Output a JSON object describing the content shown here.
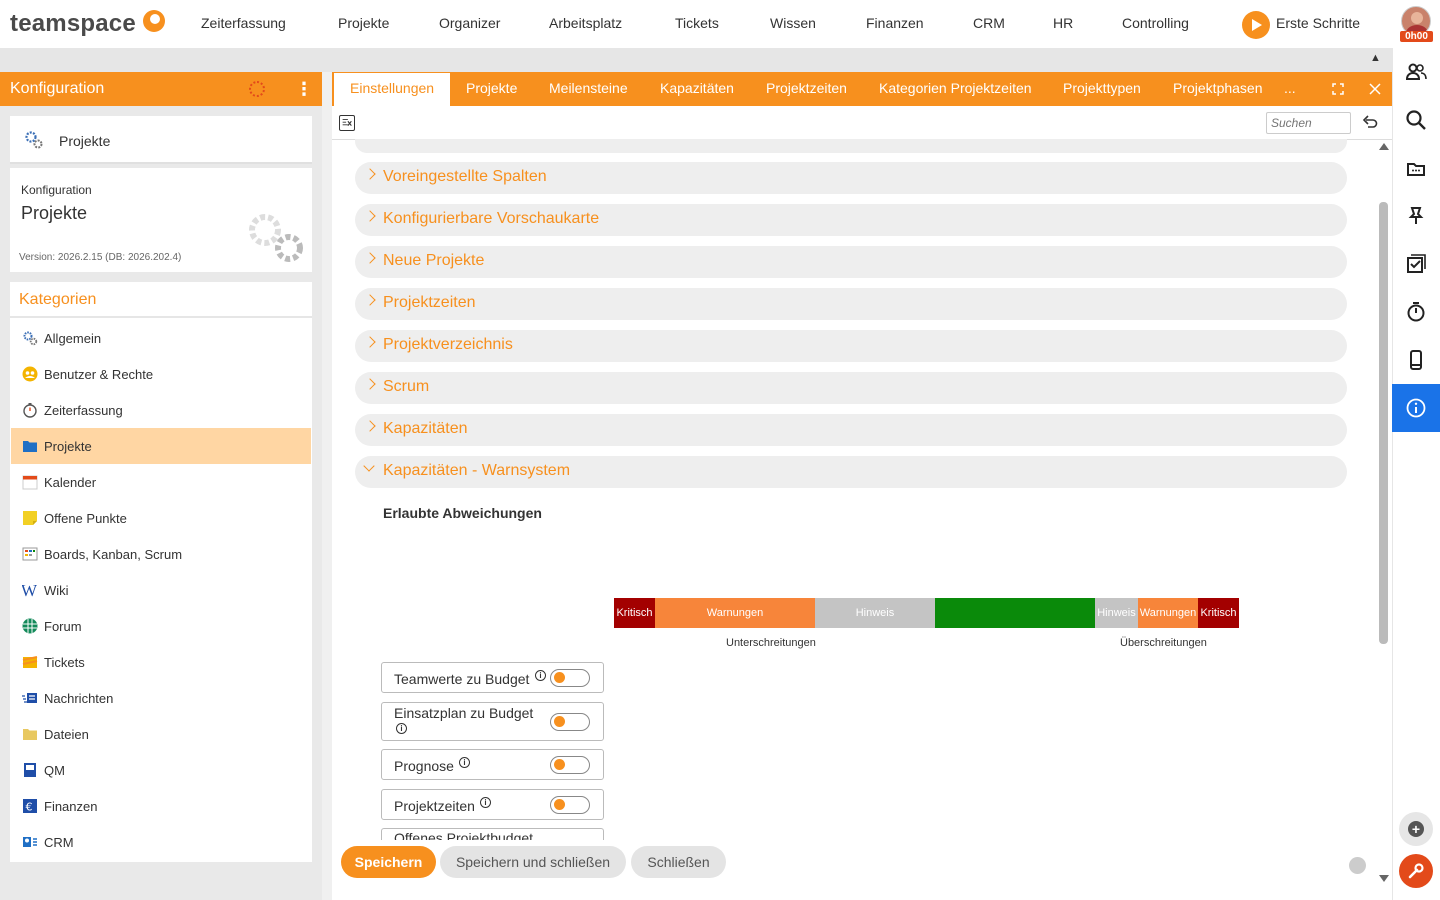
{
  "brand": {
    "name": "teamspace"
  },
  "nav": {
    "items": [
      "Zeiterfassung",
      "Projekte",
      "Organizer",
      "Arbeitsplatz",
      "Tickets",
      "Wissen",
      "Finanzen",
      "CRM",
      "HR",
      "Controlling"
    ],
    "start_label": "Erste Schritte",
    "timer": "0h00"
  },
  "left": {
    "header_title": "Konfiguration",
    "card1_label": "Projekte",
    "card2_sub": "Konfiguration",
    "card2_title": "Projekte",
    "version": "Version: 2026.2.15 (DB: 2026.202.4)",
    "kat_title": "Kategorien",
    "categories": [
      {
        "label": "Allgemein",
        "icon": "gears-icon"
      },
      {
        "label": "Benutzer & Rechte",
        "icon": "users-icon"
      },
      {
        "label": "Zeiterfassung",
        "icon": "stopwatch-icon"
      },
      {
        "label": "Projekte",
        "icon": "folder-icon",
        "selected": true
      },
      {
        "label": "Kalender",
        "icon": "calendar-icon"
      },
      {
        "label": "Offene Punkte",
        "icon": "sticky-note-icon"
      },
      {
        "label": "Boards, Kanban, Scrum",
        "icon": "board-icon"
      },
      {
        "label": "Wiki",
        "icon": "wiki-icon"
      },
      {
        "label": "Forum",
        "icon": "forum-icon"
      },
      {
        "label": "Tickets",
        "icon": "tickets-icon"
      },
      {
        "label": "Nachrichten",
        "icon": "messages-icon"
      },
      {
        "label": "Dateien",
        "icon": "files-icon"
      },
      {
        "label": "QM",
        "icon": "qm-icon"
      },
      {
        "label": "Finanzen",
        "icon": "euro-icon"
      },
      {
        "label": "CRM",
        "icon": "crm-icon"
      }
    ]
  },
  "tabs": {
    "items": [
      "Einstellungen",
      "Projekte",
      "Meilensteine",
      "Kapazitäten",
      "Projektzeiten",
      "Kategorien Projektzeiten",
      "Projekttypen",
      "Projektphasen"
    ],
    "active": "Einstellungen",
    "more": "..."
  },
  "toolbar": {
    "search_placeholder": "Suchen"
  },
  "sections": [
    {
      "label": "Voreingestellte Spalten",
      "open": false
    },
    {
      "label": "Konfigurierbare Vorschaukarte",
      "open": false
    },
    {
      "label": "Neue Projekte",
      "open": false
    },
    {
      "label": "Projektzeiten",
      "open": false
    },
    {
      "label": "Projektverzeichnis",
      "open": false
    },
    {
      "label": "Scrum",
      "open": false
    },
    {
      "label": "Kapazitäten",
      "open": false
    },
    {
      "label": "Kapazitäten - Warnsystem",
      "open": true
    }
  ],
  "warnsystem": {
    "heading": "Erlaubte Abweichungen",
    "segments": [
      {
        "label": "Kritisch",
        "color": "#a30000"
      },
      {
        "label": "Warnungen",
        "color": "#f7853a"
      },
      {
        "label": "Hinweis",
        "color": "#c4c4c4"
      },
      {
        "label": "",
        "color": "#0a8a0a"
      },
      {
        "label": "Hinweis",
        "color": "#c4c4c4"
      },
      {
        "label": "Warnungen",
        "color": "#f7853a"
      },
      {
        "label": "Kritisch",
        "color": "#a30000"
      }
    ],
    "label_left": "Unterschreitungen",
    "label_right": "Überschreitungen",
    "toggles": [
      {
        "label": "Teamwerte zu Budget",
        "info": true,
        "on": false
      },
      {
        "label": "Einsatzplan zu Budget",
        "info": true,
        "on": false
      },
      {
        "label": "Prognose",
        "info": true,
        "on": false
      },
      {
        "label": "Projektzeiten",
        "info": true,
        "on": false
      }
    ],
    "cut_off_label": "Offenes Projektbudget"
  },
  "footer": {
    "save": "Speichern",
    "save_close": "Speichern und schließen",
    "close": "Schließen"
  },
  "colors": {
    "accent": "#f7901e",
    "info_active": "#1a73e8",
    "danger": "#e34a1a"
  }
}
